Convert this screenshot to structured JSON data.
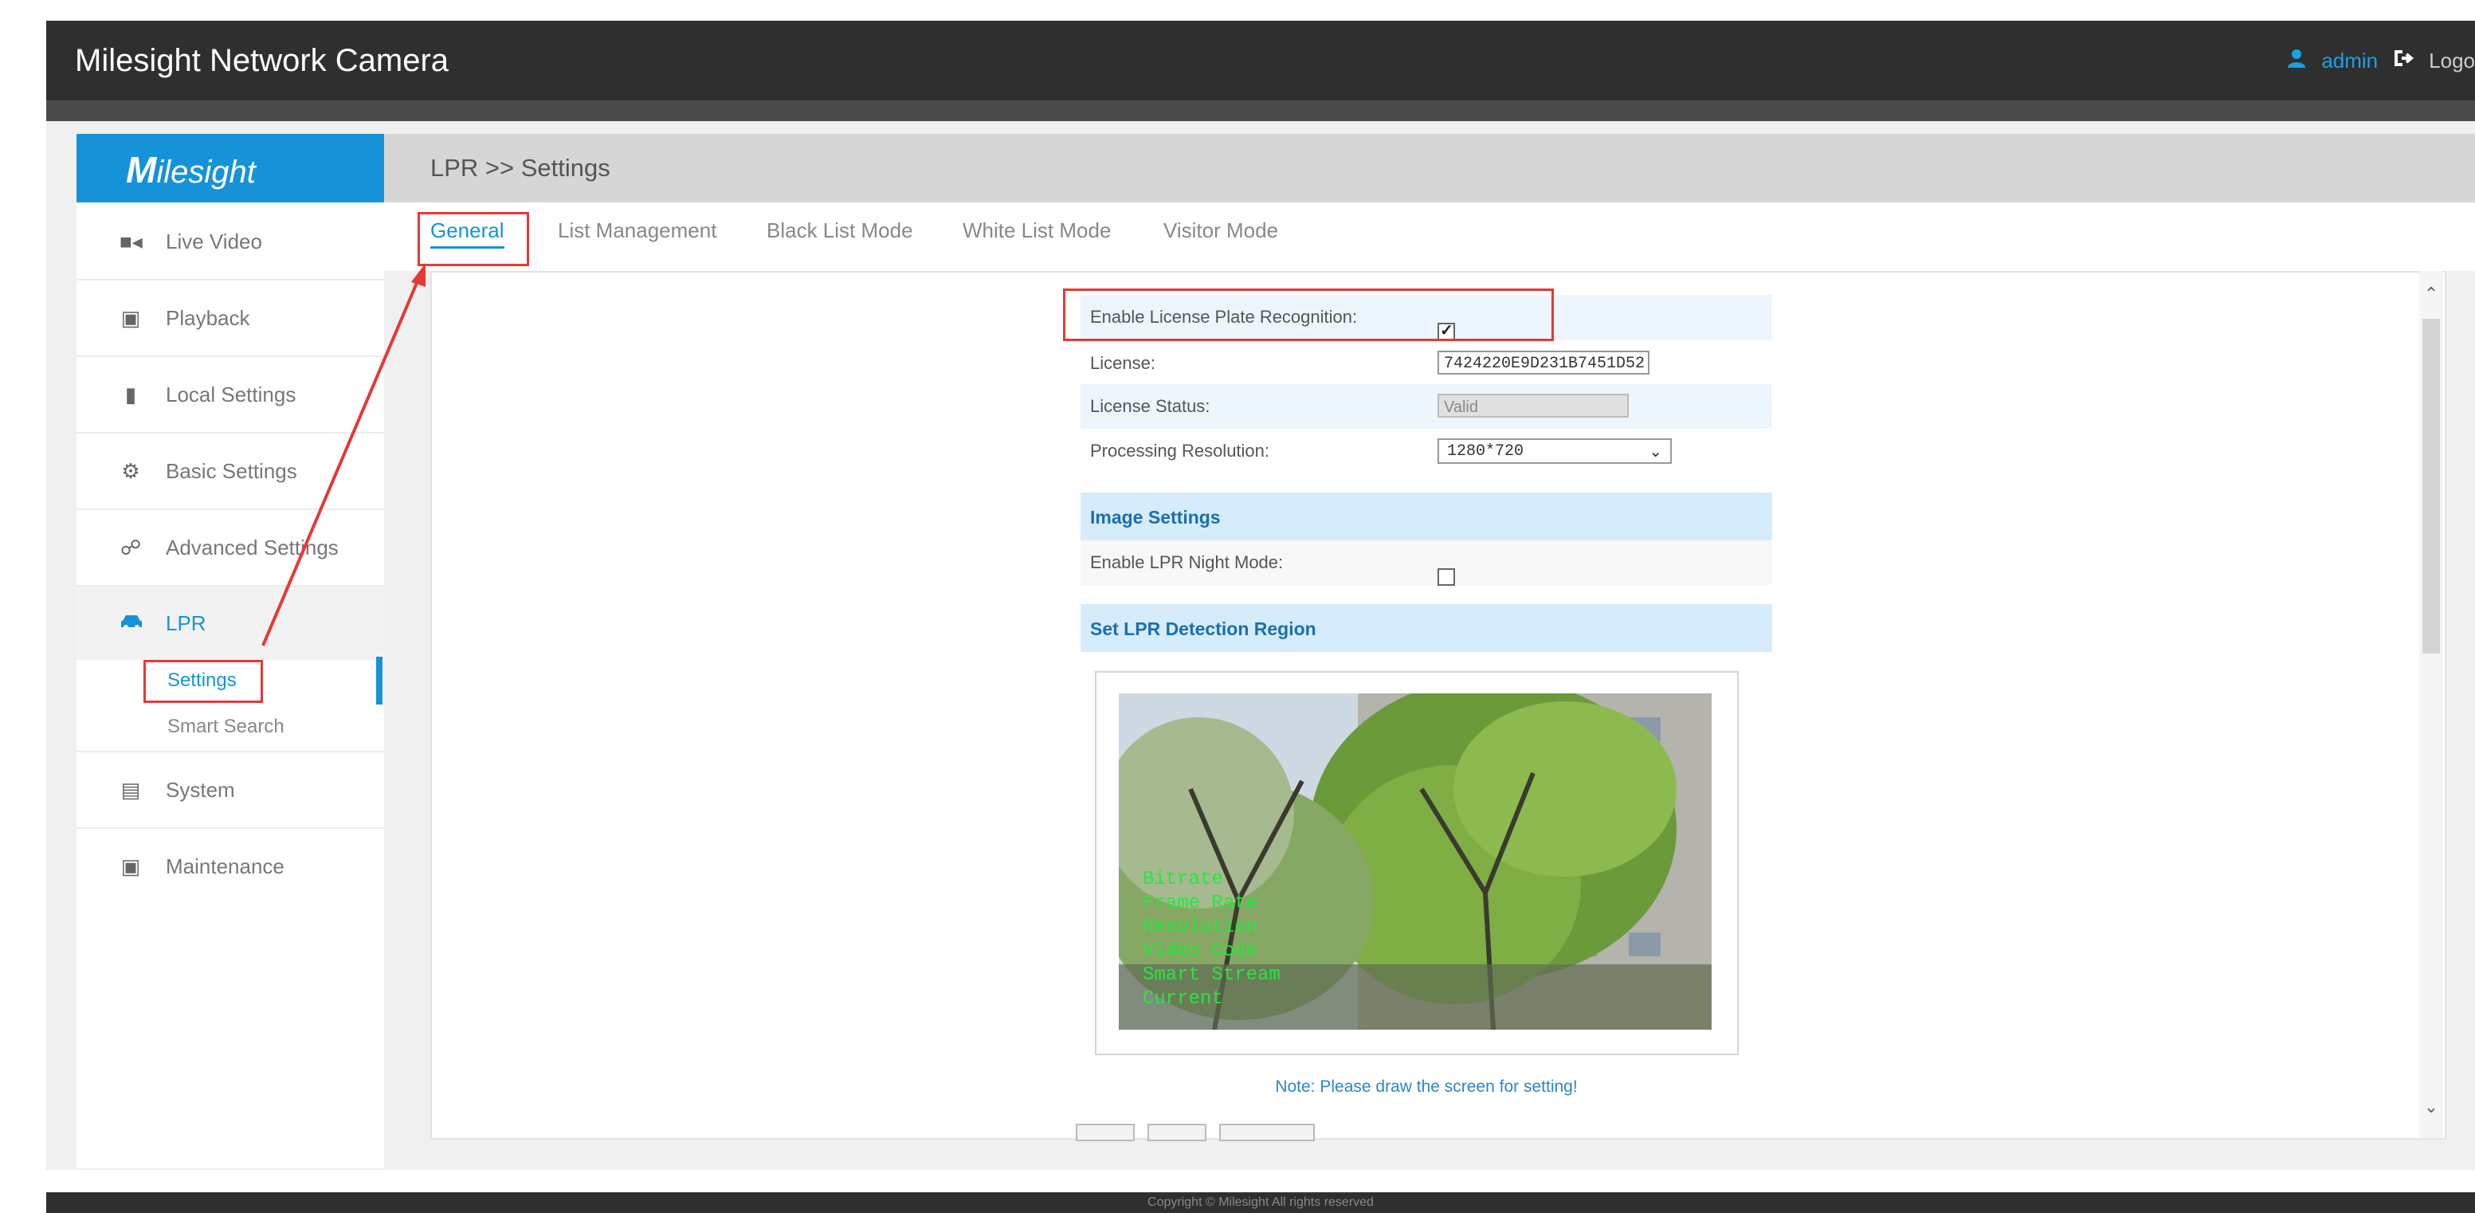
{
  "header": {
    "title": "Milesight Network Camera",
    "user": "admin",
    "logout": "Logo"
  },
  "brand": {
    "logo_initial": "M",
    "logo_text": "ilesight"
  },
  "breadcrumb": "LPR >> Settings",
  "sidebar": {
    "items": [
      {
        "label": "Live Video",
        "icon": "video-camera-icon"
      },
      {
        "label": "Playback",
        "icon": "playback-icon"
      },
      {
        "label": "Local Settings",
        "icon": "folder-icon"
      },
      {
        "label": "Basic Settings",
        "icon": "gear-icon"
      },
      {
        "label": "Advanced Settings",
        "icon": "advanced-gear-icon"
      },
      {
        "label": "LPR",
        "icon": "car-icon"
      },
      {
        "label": "System",
        "icon": "monitor-icon"
      },
      {
        "label": "Maintenance",
        "icon": "toolbox-icon"
      }
    ],
    "sub_items": [
      {
        "label": "Settings"
      },
      {
        "label": "Smart Search"
      }
    ]
  },
  "tabs": [
    "General",
    "List Management",
    "Black List Mode",
    "White List Mode",
    "Visitor Mode"
  ],
  "form": {
    "enable_lpr_label": "Enable License Plate Recognition:",
    "enable_lpr_checked": true,
    "license_label": "License:",
    "license_value": "7424220E9D231B7451D52",
    "license_status_label": "License Status:",
    "license_status_value": "Valid",
    "resolution_label": "Processing Resolution:",
    "resolution_value": "1280*720",
    "image_settings_title": "Image Settings",
    "night_mode_label": "Enable LPR Night Mode:",
    "night_mode_checked": false,
    "detection_region_title": "Set LPR Detection Region"
  },
  "preview_osd": [
    "Bitrate",
    "Frame Rate",
    "Resolution",
    "Video Code",
    "Smart Stream",
    "Current"
  ],
  "note": "Note: Please draw the screen for setting!",
  "footer": "Copyright © Milesight All rights reserved",
  "colors": {
    "accent": "#1693d8",
    "header_bg": "#2f2f2f",
    "annotation_red": "#e53935"
  }
}
